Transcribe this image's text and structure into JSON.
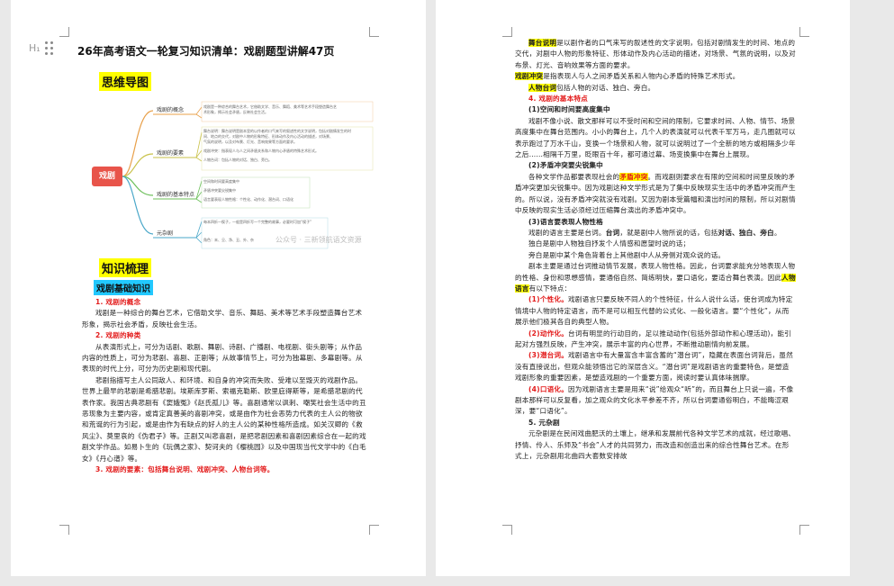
{
  "left_page": {
    "title": "26年高考语文一轮复习知识清单：戏剧题型讲解47页",
    "gutter_icon": "H₁",
    "mindmap_heading": "思维导图",
    "mindmap": {
      "center": "戏剧",
      "branches": [
        {
          "label": "戏剧的概念",
          "leaves": [
            "戏剧是一种综合的舞台艺术，它借助文学、音乐、舞蹈、美术等艺术手段塑造舞台艺",
            "术形象，揭示社会矛盾，反映社会生活。"
          ]
        },
        {
          "label": "戏剧的要素",
          "leaves": [
            "舞台说明：舞台说明是剧本里的以作者的口气来写的叙述性的文字说明，包括对剧情发生的时",
            "间、地点的交代，对剧中人物的形象特征、形体动作及内心活动的描述，对场景、",
            "气氛的说明，以及对布景、灯光、音响效果等方面的要求。",
            "戏剧冲突：指表现人与人之间矛盾关系和人物内心矛盾的特殊艺术形式。",
            "人物台词：包括人物的对话、独白、旁白。"
          ]
        },
        {
          "label": "戏剧的基本特点",
          "leaves": [
            "空间和时间要高度集中",
            "矛盾冲突要尖锐集中",
            "语言要表现人物性格：个性化、动作化、潜台词、口语化"
          ]
        },
        {
          "label": "元杂剧",
          "leaves": [
            "每本四折一楔子，一般是四折写一个完整的故事，必要时可加“楔子”",
            "角色：末、旦、净、丑、外、杂"
          ]
        }
      ],
      "watermark": "公众号 · 三新领航语文资源"
    },
    "section_heading": "知识梳理",
    "sub_heading": "戏剧基础知识",
    "items": [
      {
        "head": "1. 戏剧的概念",
        "text": "戏剧是一种综合的舞台艺术，它借助文学、音乐、舞蹈、美术等艺术手段塑造舞台艺术形象，揭示社会矛盾，反映社会生活。"
      },
      {
        "head": "2. 戏剧的种类",
        "text": "从表演形式上，可分为话剧、歌剧、舞剧、诗剧、广播剧、电视剧、街头剧等；从作品内容的性质上，可分为悲剧、喜剧、正剧等；从故事情节上，可分为独幕剧、多幕剧等。从表现的时代上分，可分为历史剧和现代剧。"
      },
      {
        "head": "",
        "text": "悲剧指描写主人公同敌人、和环境、和自身的冲突而失败、受难以至毁灭的戏剧作品。世界上最早的悲剧是希腊悲剧。埃斯库罗斯、索福克勒斯、欧里庇得斯等，是希腊悲剧的代表作家。我国古典悲剧有《窦娥冤》《赵氏孤儿》等。喜剧通常以讽刺、嘲笑社会生活中的丑恶现象为主要内容，或肯定真善美的喜剧冲突，或是由作为社会恶势力代表的主人公的物欲和荒诞的行为引起，或是由作为有缺点的好人的主人公的某种性格所造成。如关汉卿的《救风尘》、莫里哀的《伪君子》等。正剧又叫悲喜剧，是把悲剧因素和喜剧因素综合在一起的戏剧文学作品。如易卜生的《玩偶之家》、契诃夫的《樱桃园》以及中国现当代文学中的《白毛女》《丹心谱》等。"
      },
      {
        "head": "3. 戏剧的要素：包括舞台说明、戏剧冲突、人物台词等。",
        "text": ""
      }
    ]
  },
  "right_page": {
    "intro": [
      {
        "term": "舞台说明",
        "text": "是以剧作者的口气来写的叙述性的文字说明，包括对剧情发生的时间、地点的交代，对剧中人物的形象特征、形体动作及内心活动的描述，对场景、气氛的说明，以及对布景、灯光、音响效果等方面的要求。"
      },
      {
        "term": "戏剧冲突",
        "text": "是指表现人与人之间矛盾关系和人物内心矛盾的特殊艺术形式。"
      },
      {
        "term": "人物台词",
        "text": "包括人物的对话、独白、旁白。"
      }
    ],
    "section4": "4. 戏剧的基本特点",
    "sub1": "(1)空间和时间要高度集中",
    "sub1_text": "戏剧不像小说、散文那样可以不受时间和空间的限制，它要求时间、人物、情节、场景高度集中在舞台范围内。小小的舞台上，几个人的表演就可以代表千军万马，走几圈就可以表示跑过了万水千山，变换一个场景和人物，就可以说明过了一个全新的地方或相隔多少年之后……相隔千万里，眨眼百十年，都可通过幕、场变换集中在舞台上展现。",
    "sub2": "(2)矛盾冲突要尖锐集中",
    "sub2_pre": "各种文学作品都要表现社会的",
    "sub2_hl": "矛盾冲突",
    "sub2_post": "。而戏剧则要求在有限的空间和时间里反映的矛盾冲突更加尖锐集中。因为戏剧这种文学形式是为了集中反映现实生活中的矛盾冲突而产生的。所以说，没有矛盾冲突就没有戏剧。又因为剧本受篇幅和演出时间的限制，所以对剧情中反映的现实生活必须经过压缩舞台演出的矛盾冲突中。",
    "sub3": "(3)语言要表现人物性格",
    "sub3_lead_a": "戏剧的语言主要是台词。",
    "sub3_lead_b": "台词",
    "sub3_lead_c": "，就是剧中人物所说的话，包括",
    "sub3_lead_d": "对话、独白、旁白",
    "sub3_lead_e": "。",
    "dialog_def": "独白是剧中人物独自抒发个人情感和愿望时说的话；",
    "aside_def": "旁白是剧中某个角色背着台上其他剧中人从旁侧对观众说的话。",
    "sub3_text_pre": "剧本主要是通过台词推动情节发展，表现人物性格。因此，台词要求能充分地表现人物的性格、身份和思想感情，要通俗自然、简练明快，要口语化，要适合舞台表演。因此",
    "sub3_hl": "人物语言",
    "sub3_text_post": "有以下特点：",
    "features": [
      {
        "head": "(1)个性化。",
        "text": "戏剧语言只要反映不同人的个性特征，什么人说什么话，使台词成为特定情境中人物的特定语言，而不是可以相互代替的公式化、一般化语言。要“个性化”，从而展示他们极其各自的典型人物。"
      },
      {
        "head": "(2)动作化。",
        "text": "台词有明显的行动目的，足以推动动作(包括外部动作和心理活动)，能引起对方强烈反映，产生冲突，展示丰富的内心世界，不断推动剧情向前发展。"
      },
      {
        "head": "(3)潜台词。",
        "text": "戏剧语言中有大量富含丰富含蓄的“潜台词”，隐藏在表面台词背后，虽然没有直接说出，但观众能领悟出它的深层含义。“潜台词”是戏剧语言的重要特色，是塑造戏剧形象的重要因素，是塑造戏剧的一个重要方面，阅读时要认真体味揣摩。"
      },
      {
        "head": "(4)口语化。",
        "text": "因为戏剧语言主要是用来“说”给观众“听”的，而且舞台上只说一遍，不像剧本那样可以反复看，加之观众的文化水平参差不齐，所以台词要通俗明白，不能晦涩艰深，要“口语化”。"
      }
    ],
    "section5": "5. 元杂剧",
    "section5_text": "元杂剧是在民间戏曲肥沃的土壤上，继承和发展前代各种文学艺术的成就，经过歌唱、抒情、伶人、乐师及“书会”人才的共同努力，而改造和创造出来的综合性舞台艺术。在形式上，元杂剧用北曲四大套数安排故"
  }
}
